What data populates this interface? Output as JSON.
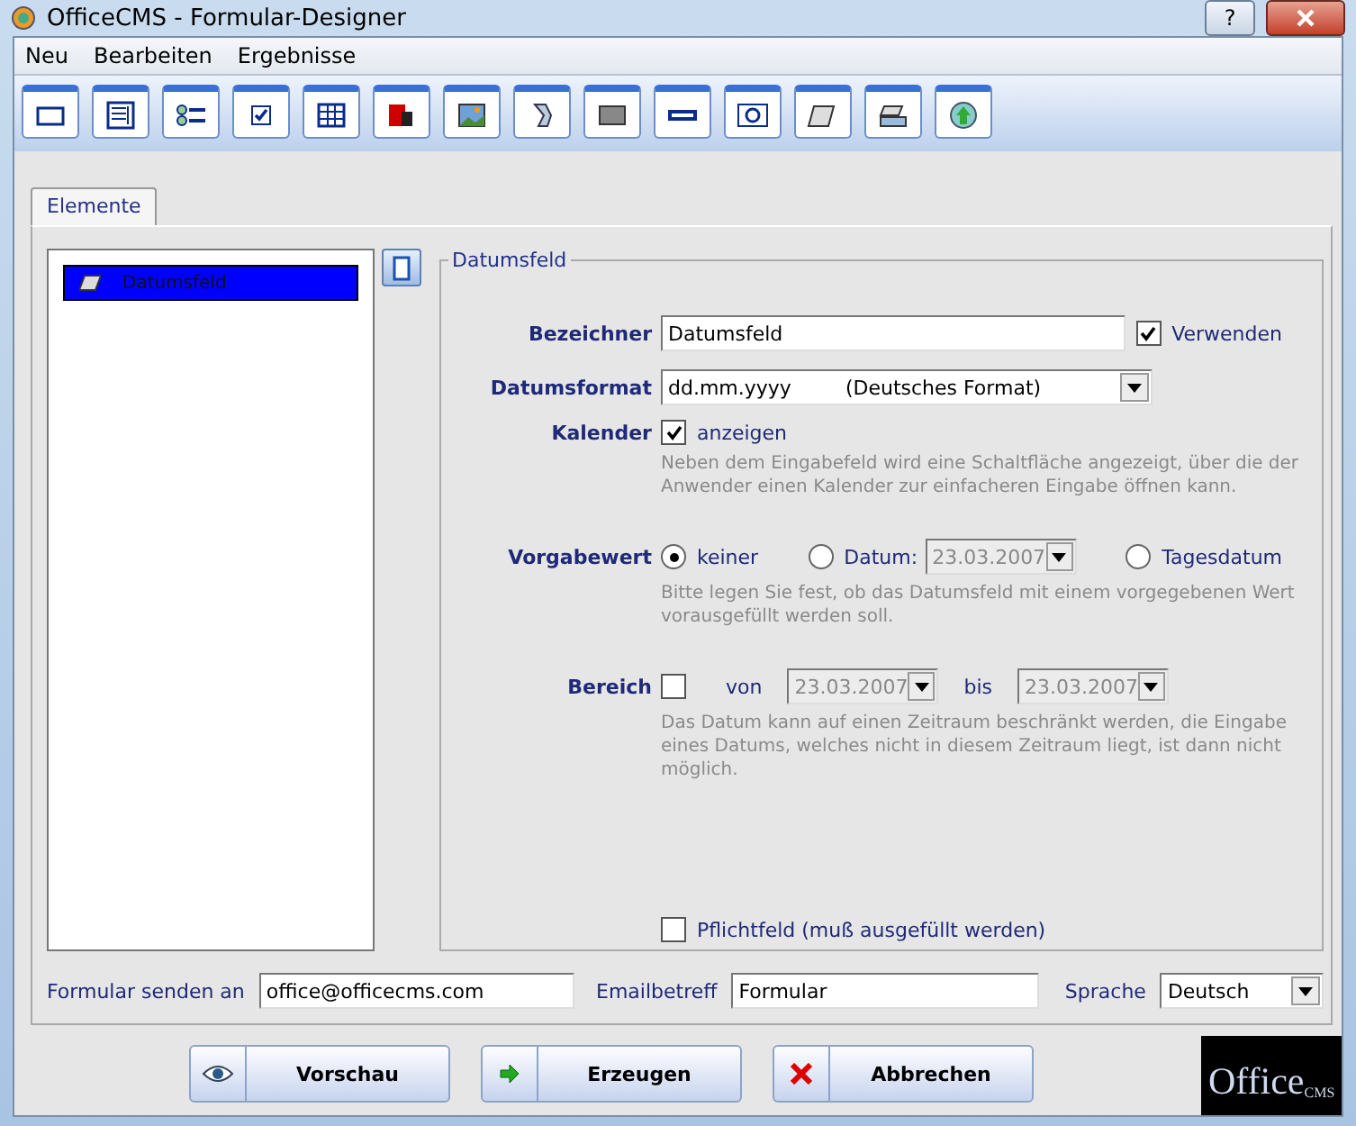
{
  "window": {
    "title": "OfficeCMS - Formular-Designer"
  },
  "menu": [
    "Neu",
    "Bearbeiten",
    "Ergebnisse"
  ],
  "tabs": [
    {
      "label": "Elemente",
      "selected": true
    }
  ],
  "elements": [
    {
      "label": "Datumsfeld",
      "selected": true
    }
  ],
  "group_title": "Datumsfeld",
  "bezeichner": {
    "label": "Bezeichner",
    "value": "Datumsfeld",
    "use_label": "Verwenden",
    "use_checked": true
  },
  "datumsformat": {
    "label": "Datumsformat",
    "format": "dd.mm.yyyy",
    "note": "(Deutsches Format)"
  },
  "kalender": {
    "label": "Kalender",
    "option": "anzeigen",
    "checked": true,
    "help": "Neben dem Eingabefeld wird eine Schaltfläche angezeigt, über die der Anwender einen Kalender zur einfacheren Eingabe öffnen kann."
  },
  "vorgabewert": {
    "label": "Vorgabewert",
    "options": [
      {
        "label": "keiner",
        "selected": true,
        "kind": "plain"
      },
      {
        "label": "Datum:",
        "selected": false,
        "kind": "date",
        "date": "23.03.2007"
      },
      {
        "label": "Tagesdatum",
        "selected": false,
        "kind": "plain"
      }
    ],
    "help": "Bitte legen Sie fest, ob das Datumsfeld mit einem vorgegebenen Wert vorausgefüllt werden soll."
  },
  "bereich": {
    "label": "Bereich",
    "checked": false,
    "from_label": "von",
    "from": "23.03.2007",
    "to_label": "bis",
    "to": "23.03.2007",
    "help": "Das Datum kann auf einen Zeitraum beschränkt werden, die Eingabe eines Datums, welches nicht in diesem Zeitraum liegt, ist dann nicht möglich."
  },
  "pflichtfeld": {
    "label": "Pflichtfeld (muß ausgefüllt werden)",
    "checked": false
  },
  "footer": {
    "send_label": "Formular senden an",
    "send": "office@officecms.com",
    "subject_label": "Emailbetreff",
    "subject": "Formular",
    "lang_label": "Sprache",
    "lang": "Deutsch"
  },
  "buttons": [
    {
      "label": "Vorschau",
      "kind": "eye"
    },
    {
      "label": "Erzeugen",
      "kind": "arrow"
    },
    {
      "label": "Abbrechen",
      "kind": "cross"
    }
  ],
  "logo": {
    "main": "Office",
    "sub": "CMS"
  },
  "title_buttons": [
    "?"
  ]
}
